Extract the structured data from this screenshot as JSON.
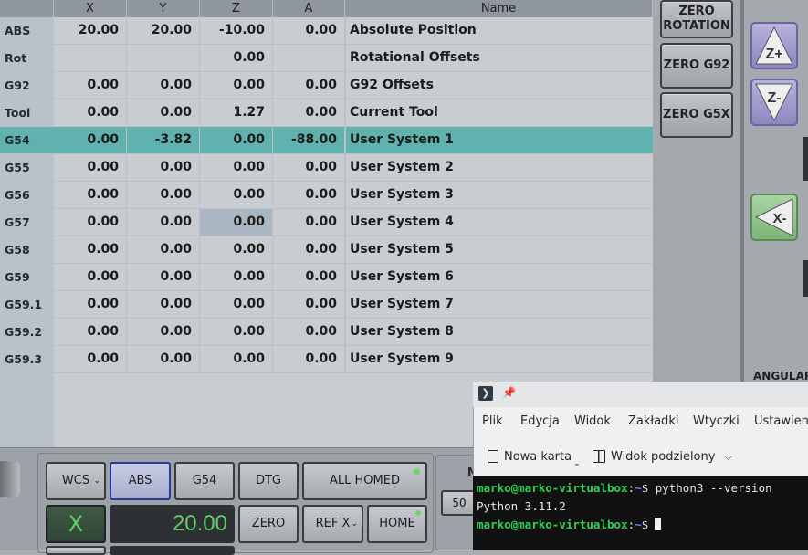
{
  "table": {
    "headers": [
      "X",
      "Y",
      "Z",
      "A",
      "Name"
    ],
    "rows": [
      {
        "label": "ABS",
        "x": "20.00",
        "y": "20.00",
        "z": "-10.00",
        "a": "0.00",
        "name": "Absolute Position"
      },
      {
        "label": "Rot",
        "x": "",
        "y": "",
        "z": "0.00",
        "a": "",
        "name": "Rotational Offsets"
      },
      {
        "label": "G92",
        "x": "0.00",
        "y": "0.00",
        "z": "0.00",
        "a": "0.00",
        "name": "G92 Offsets"
      },
      {
        "label": "Tool",
        "x": "0.00",
        "y": "0.00",
        "z": "1.27",
        "a": "0.00",
        "name": "Current Tool"
      },
      {
        "label": "G54",
        "x": "0.00",
        "y": "-3.82",
        "z": "0.00",
        "a": "-88.00",
        "name": "User System 1"
      },
      {
        "label": "G55",
        "x": "0.00",
        "y": "0.00",
        "z": "0.00",
        "a": "0.00",
        "name": "User System 2"
      },
      {
        "label": "G56",
        "x": "0.00",
        "y": "0.00",
        "z": "0.00",
        "a": "0.00",
        "name": "User System 3"
      },
      {
        "label": "G57",
        "x": "0.00",
        "y": "0.00",
        "z": "0.00",
        "a": "0.00",
        "name": "User System 4"
      },
      {
        "label": "G58",
        "x": "0.00",
        "y": "0.00",
        "z": "0.00",
        "a": "0.00",
        "name": "User System 5"
      },
      {
        "label": "G59",
        "x": "0.00",
        "y": "0.00",
        "z": "0.00",
        "a": "0.00",
        "name": "User System 6"
      },
      {
        "label": "G59.1",
        "x": "0.00",
        "y": "0.00",
        "z": "0.00",
        "a": "0.00",
        "name": "User System 7"
      },
      {
        "label": "G59.2",
        "x": "0.00",
        "y": "0.00",
        "z": "0.00",
        "a": "0.00",
        "name": "User System 8"
      },
      {
        "label": "G59.3",
        "x": "0.00",
        "y": "0.00",
        "z": "0.00",
        "a": "0.00",
        "name": "User System 9"
      }
    ],
    "selected_row_label": "G54",
    "highlighted_cell": "G57 Z",
    "selected_row_color": "#5fb2ae"
  },
  "right_panel": {
    "zero_rotation_line1": "ZERO",
    "zero_rotation_line2": "ROTATION",
    "zero_g92": "ZERO G92",
    "zero_g5x": "ZERO G5X",
    "jog_z_plus": "Z+",
    "jog_z_minus": "Z-",
    "jog_x_minus": "X-",
    "angular_label": "ANGULAR"
  },
  "controls": {
    "wcs": "WCS",
    "abs": "ABS",
    "g54": "G54",
    "dtg": "DTG",
    "all_homed": "ALL HOMED",
    "axis_letter": "X",
    "axis_value": "20.00",
    "zero": "ZERO",
    "ref_x": "REF X",
    "home": "HOME",
    "partial_label": "M",
    "partial_value": "50",
    "homed_led_color": "#6fd36f"
  },
  "terminal": {
    "menu": [
      "Plik",
      "Edycja",
      "Widok",
      "Zakładki",
      "Wtyczki",
      "Ustawienia"
    ],
    "new_tab": "Nowa karta",
    "split_view": "Widok podzielony",
    "prompt_user": "marko@marko-virtualbox",
    "prompt_sep": ":",
    "prompt_path": "~",
    "prompt_dollar": "$",
    "command": " python3 --version",
    "output": "Python 3.11.2"
  }
}
